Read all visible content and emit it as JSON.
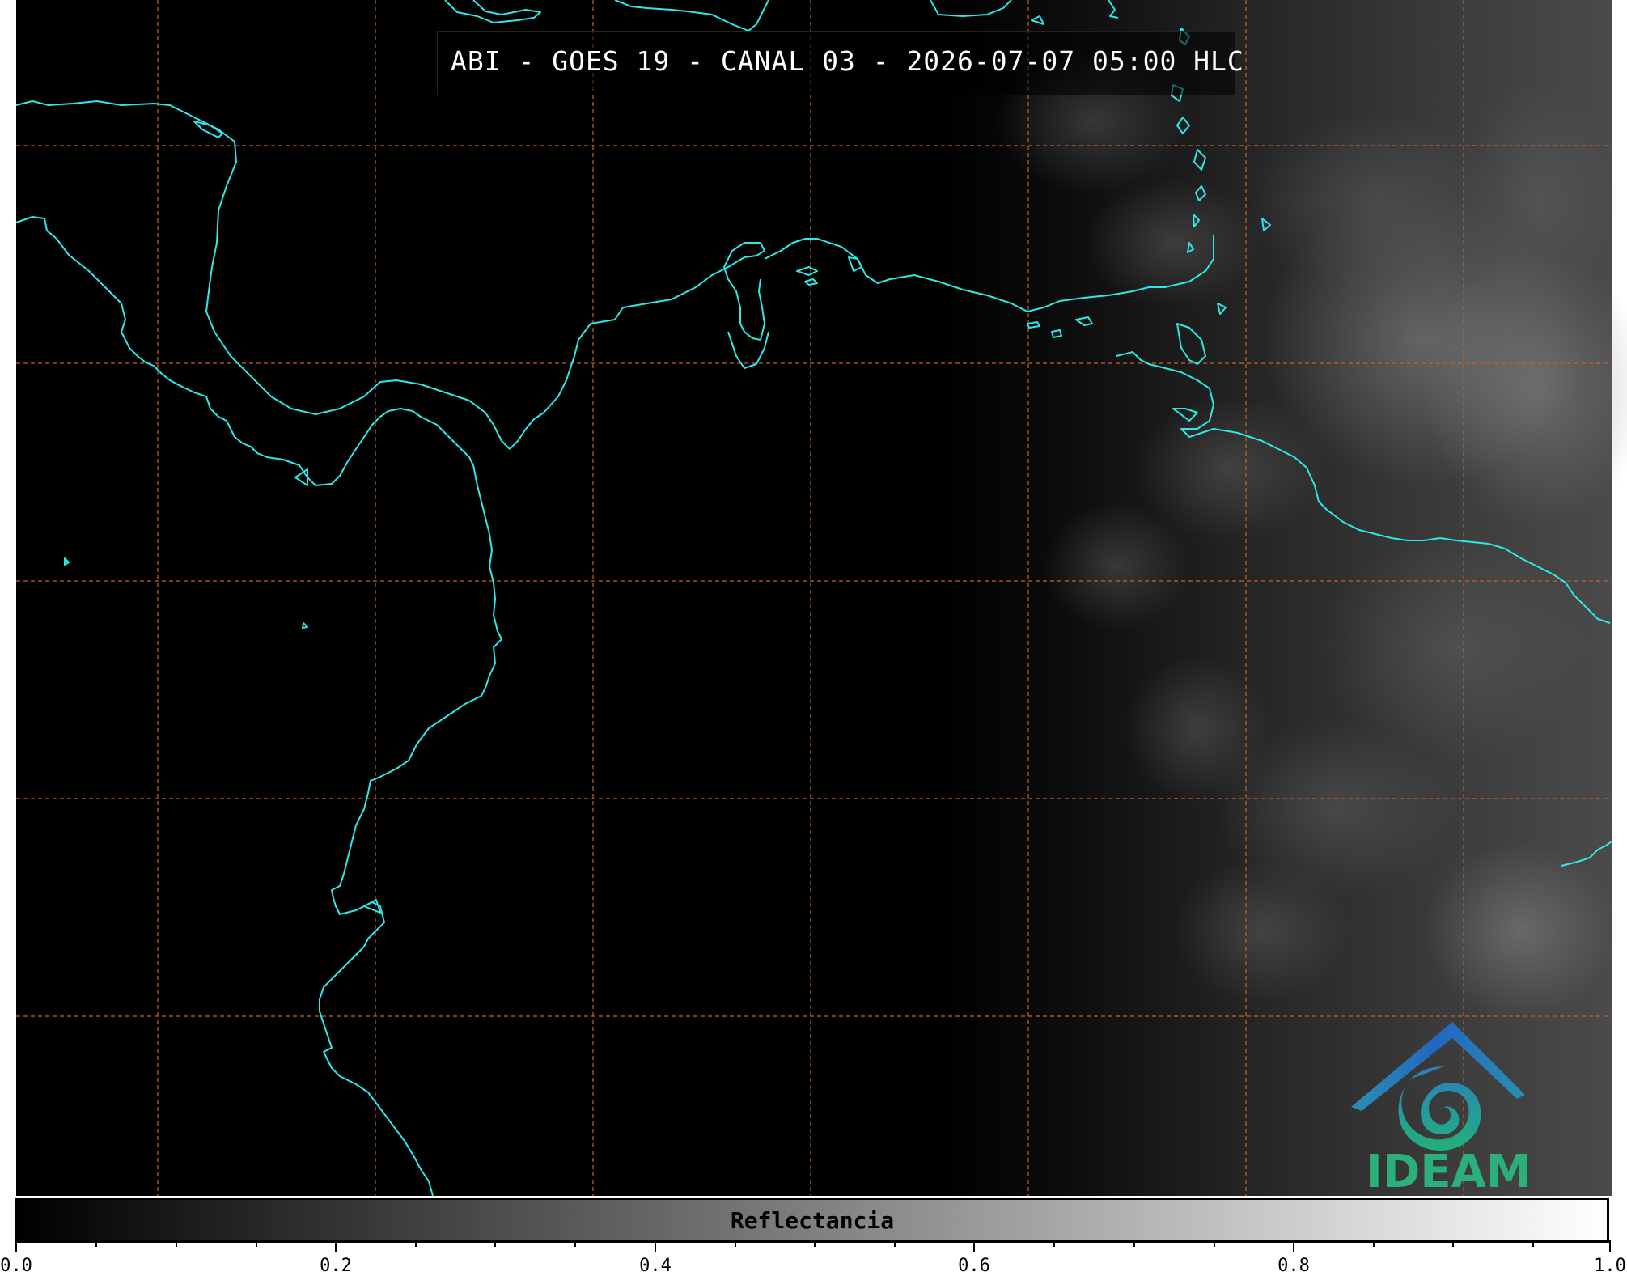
{
  "title": "ABI - GOES 19 - CANAL 03 - 2026-07-07 05:00 HLC",
  "logo": {
    "text": "IDEAM"
  },
  "colorbar": {
    "label": "Reflectancia",
    "ticks": [
      "0.0",
      "0.2",
      "0.4",
      "0.6",
      "0.8",
      "1.0"
    ],
    "range": [
      0.0,
      1.0
    ]
  },
  "colors": {
    "coastline": "#2ee8e8",
    "gridline": "#c0652a",
    "background": "#000000"
  }
}
